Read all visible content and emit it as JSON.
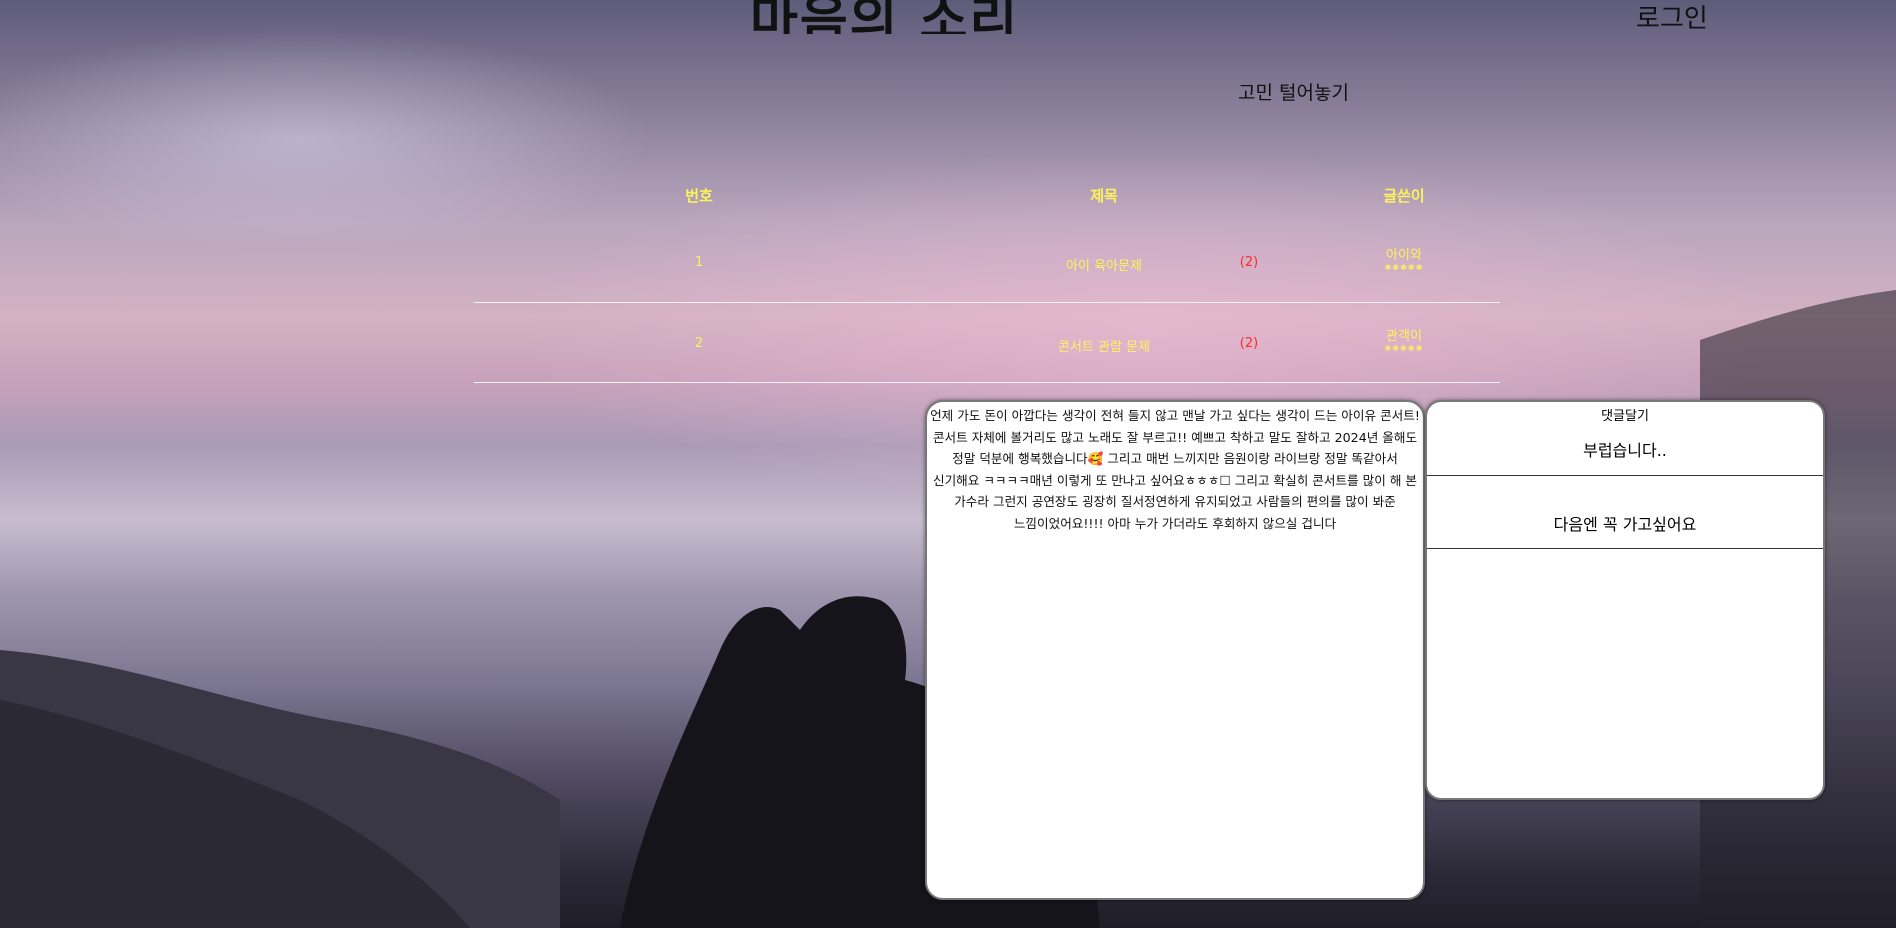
{
  "header": {
    "site_title": "마음의 소리",
    "login_label": "로그인",
    "board_title": "고민 털어놓기"
  },
  "board": {
    "columns": [
      "번호",
      "제목",
      "글쓴이"
    ],
    "rows": [
      {
        "no": "1",
        "title": "아이 육아문제",
        "comment_count": "(2)",
        "author": "아이와",
        "author_mask": "*****"
      },
      {
        "no": "2",
        "title": "콘서트 관람 문제",
        "comment_count": "(2)",
        "author": "관객이",
        "author_mask": "*****"
      }
    ],
    "colors": {
      "text": "#fff35a",
      "count": "#ff2a2a",
      "divider": "#f2f2f2"
    }
  },
  "post": {
    "body": "언제 가도 돈이 아깝다는 생각이 전혀 들지 않고 맨날 가고 싶다는 생각이 드는 아이유 콘서트! 콘서트 자체에 볼거리도 많고 노래도 잘 부르고!! 예쁘고 착하고 말도 잘하고 2024년 올해도 정말 덕분에 행복했습니다🥰 그리고 매번 느끼지만 음원이랑 라이브랑 정말 똑같아서 신기해요 ㅋㅋㅋㅋ매년 이렇게 또 만나고 싶어요ㅎㅎㅎ☐ 그리고 확실히 콘서트를 많이 해 본 가수라 그런지 공연장도 굉장히 질서정연하게 유지되었고 사람들의 편의를 많이 봐준 느낌이었어요!!!! 아마 누가 가더라도 후회하지 않으실 겁니다"
  },
  "comments": {
    "header": "댓글달기",
    "items": [
      "부럽습니다..",
      "다음엔 꼭 가고싶어요"
    ]
  }
}
